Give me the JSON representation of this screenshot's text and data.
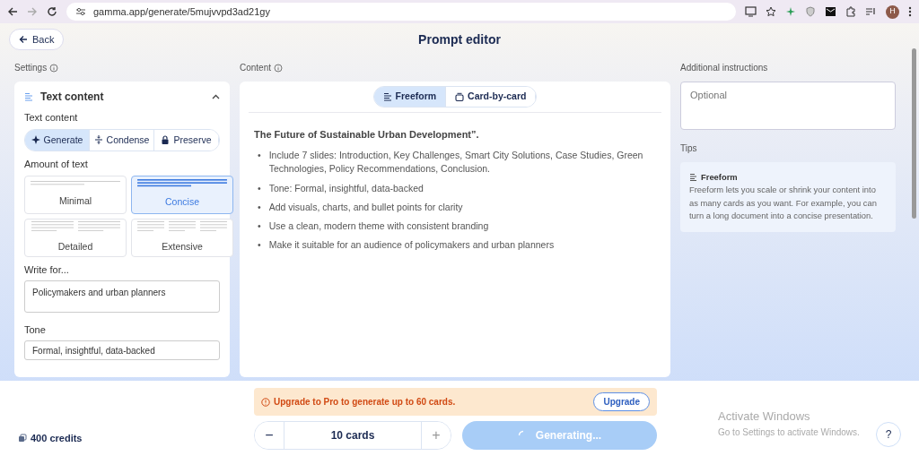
{
  "browser": {
    "url": "gamma.app/generate/5mujvvpd3ad21gy",
    "avatar": "H"
  },
  "header": {
    "back": "Back",
    "title": "Prompt editor"
  },
  "settings": {
    "label": "Settings",
    "section_title": "Text content",
    "expanded": true,
    "text_mode": {
      "label": "Text content",
      "options": [
        {
          "label": "Generate",
          "kind": "sparkle",
          "selected": true
        },
        {
          "label": "Condense",
          "kind": "condense",
          "selected": false
        },
        {
          "label": "Preserve",
          "kind": "lock",
          "selected": false
        }
      ]
    },
    "amount": {
      "label": "Amount of text",
      "options": [
        {
          "label": "Minimal",
          "kind": "minimal",
          "selected": false
        },
        {
          "label": "Concise",
          "kind": "concise",
          "selected": true
        },
        {
          "label": "Detailed",
          "kind": "detailed",
          "selected": false
        },
        {
          "label": "Extensive",
          "kind": "extensive",
          "selected": false
        }
      ]
    },
    "write_for": {
      "label": "Write for...",
      "value": "Policymakers and urban planners"
    },
    "tone": {
      "label": "Tone",
      "value": "Formal, insightful, data-backed"
    }
  },
  "content": {
    "label": "Content",
    "modes": [
      {
        "label": "Freeform",
        "kind": "lines",
        "selected": true
      },
      {
        "label": "Card-by-card",
        "kind": "cards",
        "selected": false
      }
    ],
    "heading": "The Future of Sustainable Urban Development”.",
    "bullets": [
      {
        "marker": "•",
        "text": "Include 7 slides: Introduction, Key Challenges, Smart City Solutions, Case Studies, Green Technologies, Policy Recommendations, Conclusion."
      },
      {
        "marker": "•",
        "text": "Tone: Formal, insightful, data-backed"
      },
      {
        "marker": "•",
        "text": "Add visuals, charts, and bullet points for clarity"
      },
      {
        "marker": "•",
        "text": "Use a clean, modern theme with consistent branding"
      },
      {
        "marker": "•",
        "text": "Make it suitable for an audience of policymakers and urban planners"
      }
    ]
  },
  "additional": {
    "label": "Additional instructions",
    "placeholder": "Optional"
  },
  "tips": {
    "label": "Tips",
    "title": "Freeform",
    "body": "Freeform lets you scale or shrink your content into as many cards as you want. For example, you can turn a long document into a concise presentation."
  },
  "footer": {
    "credits": "400 credits",
    "banner": {
      "message": "Upgrade to Pro to generate up to 60 cards.",
      "button": "Upgrade"
    },
    "stepper": {
      "minus": "−",
      "value": "10 cards",
      "plus": "+"
    },
    "generate": {
      "label": "Generating...",
      "busy": true
    },
    "help": "?"
  },
  "os_notice": {
    "title": "Activate Windows",
    "body": "Go to Settings to activate Windows."
  }
}
